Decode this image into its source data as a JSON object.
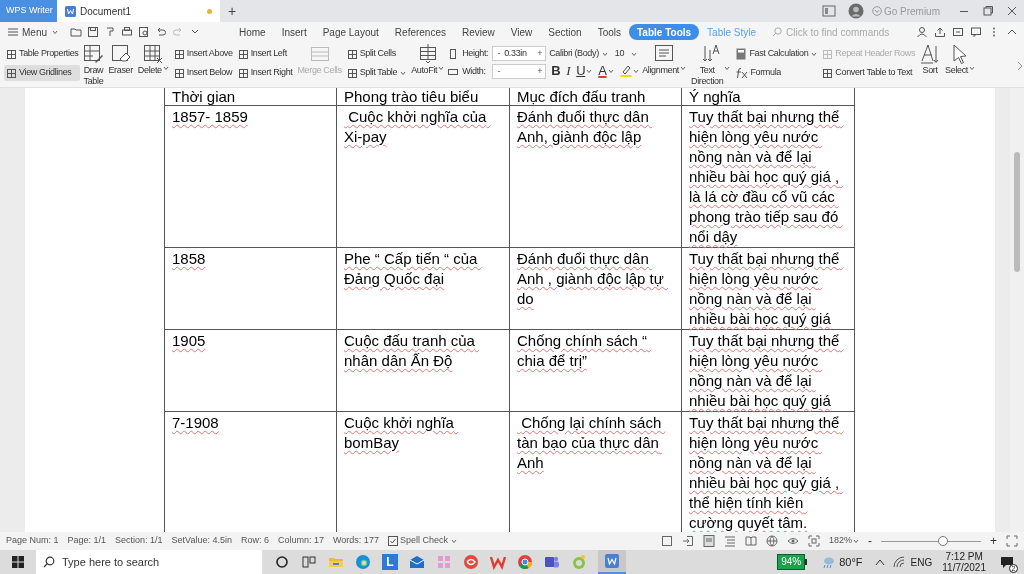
{
  "title_bar": {
    "app_tab": "WPS Writer",
    "doc_tab": {
      "label": "Document1",
      "unsaved": true
    },
    "new_tab": "+",
    "premium": "Go Premium"
  },
  "menu_bar": {
    "menu": "Menu",
    "tabs": [
      {
        "label": "Home",
        "selected": false,
        "kind": "plain"
      },
      {
        "label": "Insert",
        "selected": false,
        "kind": "plain"
      },
      {
        "label": "Page Layout",
        "selected": false,
        "kind": "plain"
      },
      {
        "label": "References",
        "selected": false,
        "kind": "plain"
      },
      {
        "label": "Review",
        "selected": false,
        "kind": "plain"
      },
      {
        "label": "View",
        "selected": false,
        "kind": "plain"
      },
      {
        "label": "Section",
        "selected": false,
        "kind": "plain"
      },
      {
        "label": "Tools",
        "selected": false,
        "kind": "plain"
      },
      {
        "label": "Table Tools",
        "selected": true,
        "kind": "context"
      },
      {
        "label": "Table Style",
        "selected": false,
        "kind": "context"
      }
    ],
    "search": {
      "placeholder": "Click to find commands"
    }
  },
  "ribbon": [
    {
      "kind": "small",
      "items": [
        {
          "label": "Table Properties",
          "selected": false,
          "disabled": false,
          "menu": false
        },
        {
          "label": "View Gridlines",
          "selected": true,
          "disabled": false,
          "menu": false
        }
      ]
    },
    {
      "kind": "large",
      "items": [
        {
          "label": "Draw\nTable",
          "disabled": false,
          "menu": false
        }
      ]
    },
    {
      "kind": "large",
      "items": [
        {
          "label": "Eraser",
          "disabled": false,
          "menu": false
        }
      ]
    },
    {
      "kind": "large",
      "items": [
        {
          "label": "Delete",
          "disabled": false,
          "menu": true
        }
      ]
    },
    {
      "kind": "small",
      "items": [
        {
          "label": "Insert Above",
          "selected": false,
          "disabled": false,
          "menu": false
        },
        {
          "label": "Insert Below",
          "selected": false,
          "disabled": false,
          "menu": false
        }
      ]
    },
    {
      "kind": "small",
      "items": [
        {
          "label": "Insert Left",
          "selected": false,
          "disabled": false,
          "menu": false
        },
        {
          "label": "Insert Right",
          "selected": false,
          "disabled": false,
          "menu": false
        }
      ]
    },
    {
      "kind": "large",
      "items": [
        {
          "label": "Merge Cells",
          "disabled": true,
          "menu": false
        }
      ]
    },
    {
      "kind": "small",
      "items": [
        {
          "label": "Split Cells",
          "selected": false,
          "disabled": false,
          "menu": false
        },
        {
          "label": "Split Table",
          "selected": false,
          "disabled": false,
          "menu": true
        }
      ]
    },
    {
      "kind": "large",
      "items": [
        {
          "label": "AutoFit",
          "disabled": false,
          "menu": true
        }
      ]
    },
    {
      "kind": "size",
      "rows": [
        {
          "label": "Height:",
          "minus": "-",
          "value": "0.33in",
          "plus": "+"
        },
        {
          "label": "Width:",
          "minus": "-",
          "plus": "+"
        }
      ]
    },
    {
      "kind": "font",
      "font": "Calibri (Body)",
      "size": "10",
      "buttons": [
        {
          "label": "B",
          "menu": false
        },
        {
          "label": "I",
          "menu": false
        },
        {
          "label": "U",
          "menu": true
        },
        {
          "label": "A",
          "menu": true
        }
      ]
    },
    {
      "kind": "large",
      "items": [
        {
          "label": "Alignment",
          "disabled": false,
          "menu": true
        }
      ]
    },
    {
      "kind": "large",
      "items": [
        {
          "label": "Text\nDirection",
          "disabled": false,
          "menu": true
        }
      ]
    },
    {
      "kind": "small",
      "items": [
        {
          "label": "Fast Calculation",
          "selected": false,
          "disabled": false,
          "menu": true
        },
        {
          "label": "Formula",
          "selected": false,
          "disabled": false,
          "menu": false
        }
      ]
    },
    {
      "kind": "small",
      "items": [
        {
          "label": "Repeat Header Rows",
          "selected": false,
          "disabled": true,
          "menu": false
        },
        {
          "label": "Convert Table to Text",
          "selected": false,
          "disabled": false,
          "menu": false
        }
      ]
    },
    {
      "kind": "large",
      "items": [
        {
          "label": "Sort",
          "disabled": false,
          "menu": false
        }
      ]
    },
    {
      "kind": "large",
      "items": [
        {
          "label": "Select",
          "disabled": false,
          "menu": true
        }
      ]
    }
  ],
  "table": {
    "columns": [
      "Thời gian",
      "Phong trào tiêu biểu",
      "Mục đích đấu tranh",
      "Ý nghĩa"
    ],
    "rows": [
      [
        "1857- 1859",
        " Cuộc khởi nghĩa của Xi-pay",
        "Đánh đuổi thực dân Anh, giành độc lập",
        "Tuy thất bại nhưng thể hiện lòng yêu nước nồng nàn và để lại nhiều bài học quý giá , là lá cờ đầu cổ vũ các phong trào tiếp sau đó nổi dậy"
      ],
      [
        "1858",
        "Phe “ Cấp tiến “ của Đảng Quốc đại",
        "Đánh đuổi thực dân Anh , giành độc lập tự do",
        "Tuy thất bại nhưng thể hiện lòng yêu nước nồng nàn và để lại nhiều bài học quý giá"
      ],
      [
        "1905",
        "Cuộc đấu tranh của nhân dân Ấn Độ",
        "Chống chính sách “ chia để trị”",
        "Tuy thất bại nhưng thể hiện lòng yêu nước nồng nàn và để lại nhiều bài học quý giá"
      ],
      [
        "7-1908",
        "Cuộc khởi nghĩa bomBay",
        " Chống lại chính sách tàn bạo của thực dân Anh",
        "Tuy thất bại nhưng thể hiện lòng yêu nước nồng nàn và để lại nhiều bài học quý giá , thể hiện tính kiên cường quyết tâm."
      ]
    ]
  },
  "status_bar": {
    "items": [
      "Page Num: 1",
      "Page: 1/1",
      "Section: 1/1",
      "SetValue: 4.5in",
      "Row: 6",
      "Column: 17",
      "Words: 177"
    ],
    "spell_check": "Spell Check",
    "zoom": "182%",
    "zoom_minus": "-",
    "zoom_plus": "+",
    "zoom_slider": {
      "level": 0.62
    }
  },
  "taskbar": {
    "search": {
      "placeholder": "Type here to search"
    },
    "letter_tile": "L",
    "battery": "94%",
    "weather": "80°F",
    "language": "ENG",
    "time": "7:12 PM",
    "date": "11/7/2021",
    "notifications": "2"
  }
}
